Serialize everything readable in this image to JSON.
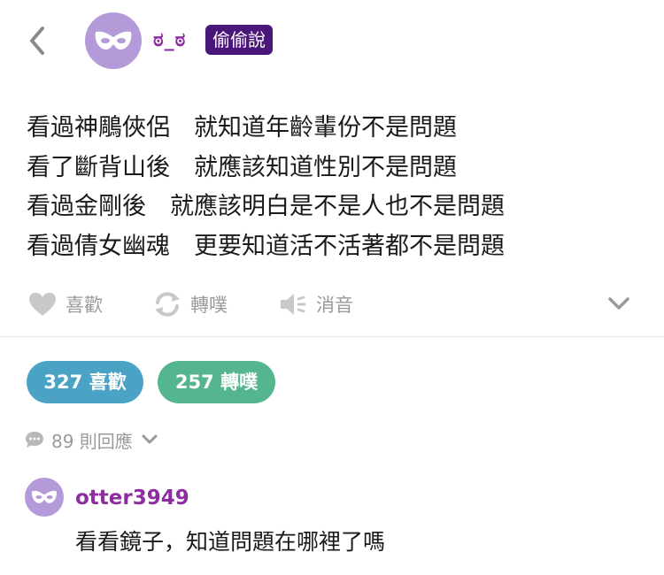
{
  "header": {
    "username": "ಠ_ಠ",
    "badge": "偷偷說",
    "back_icon": "chevron-left-icon",
    "avatar_icon": "mask-icon"
  },
  "post": {
    "lines": [
      "看過神鵰俠侶　就知道年齡輩份不是問題",
      "看了斷背山後　就應該知道性別不是問題",
      "看過金剛後　就應該明白是不是人也不是問題",
      "看過倩女幽魂　更要知道活不活著都不是問題"
    ]
  },
  "actions": {
    "like_label": "喜歡",
    "share_label": "轉噗",
    "mute_label": "消音"
  },
  "stats": {
    "likes": "327 喜歡",
    "shares": "257 轉噗",
    "replies": "89 則回應"
  },
  "comment": {
    "user": "otter3949",
    "text": "看看鏡子，知道問題在哪裡了嗎"
  },
  "colors": {
    "username": "#8e2ca1",
    "badge_bg": "#4b1679",
    "likes_pill": "#4aa3c5",
    "shares_pill": "#55b58f",
    "avatar_bg": "#b49ad8",
    "muted_text": "#9a9a9a"
  }
}
